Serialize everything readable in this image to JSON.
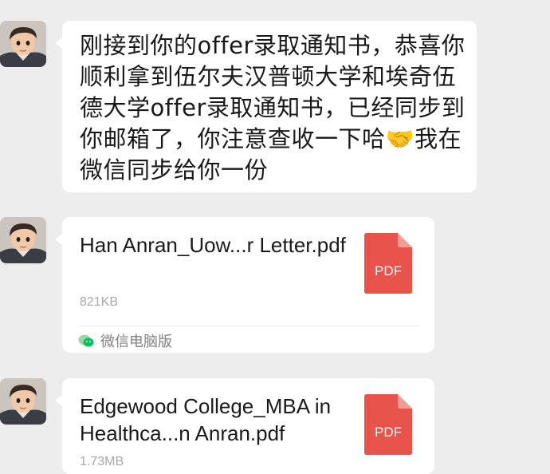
{
  "messages": [
    {
      "type": "text",
      "text": "刚接到你的offer录取通知书，恭喜你顺利拿到伍尔夫汉普顿大学和埃奇伍德大学offer录取通知书，已经同步到你邮箱了，你注意查收一下哈🤝我在微信同步给你一份"
    },
    {
      "type": "file",
      "file_name": "Han Anran_Uow...r Letter.pdf",
      "file_size": "821KB",
      "file_icon_label": "PDF",
      "source_label": "微信电脑版"
    },
    {
      "type": "file",
      "file_name": "Edgewood College_MBA in Healthca...n Anran.pdf",
      "file_size": "1.73MB",
      "file_icon_label": "PDF"
    }
  ],
  "colors": {
    "background": "#ededed",
    "bubble": "#ffffff",
    "pdf_red": "#e8534b",
    "wechat_green": "#07c160"
  },
  "icons": {
    "avatar": "cartoon-boy-avatar",
    "file_type": "pdf-file-icon",
    "source": "wechat-icon"
  }
}
